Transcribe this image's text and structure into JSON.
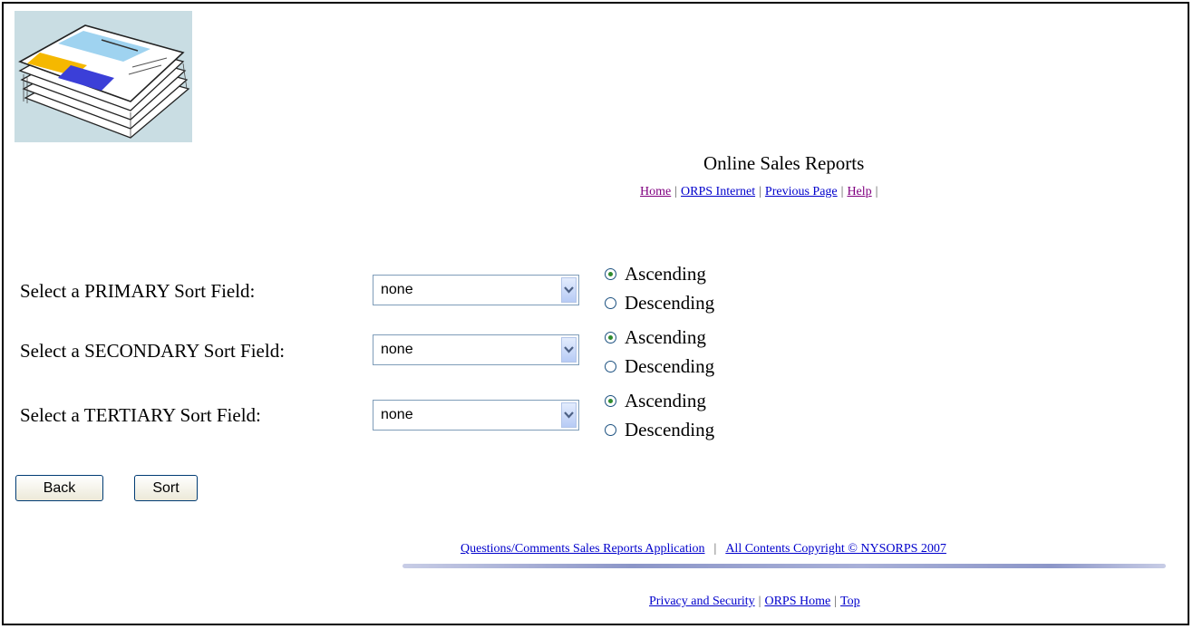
{
  "header": {
    "title": "Online Sales Reports",
    "nav": [
      {
        "label": "Home"
      },
      {
        "label": "ORPS Internet"
      },
      {
        "label": "Previous Page"
      },
      {
        "label": "Help"
      }
    ]
  },
  "sort_rows": [
    {
      "label": "Select a PRIMARY Sort Field:",
      "selected": "none",
      "order_options": [
        "Ascending",
        "Descending"
      ],
      "checked": "Ascending"
    },
    {
      "label": "Select a SECONDARY Sort Field:",
      "selected": "none",
      "order_options": [
        "Ascending",
        "Descending"
      ],
      "checked": "Ascending"
    },
    {
      "label": "Select a TERTIARY Sort Field:",
      "selected": "none",
      "order_options": [
        "Ascending",
        "Descending"
      ],
      "checked": "Ascending"
    }
  ],
  "buttons": {
    "back": "Back",
    "sort": "Sort"
  },
  "footer": {
    "questions_link": "Questions/Comments Sales Reports Application",
    "copyright_link": "All Contents Copyright © NYSORPS 2007",
    "links": [
      {
        "label": "Privacy and Security"
      },
      {
        "label": "ORPS Home"
      },
      {
        "label": "Top"
      }
    ]
  },
  "colors": {
    "link": "#0000cc",
    "visited_link": "#800080",
    "logo_background": "#c9dde3"
  },
  "icons": {
    "logo": "newspaper-stack-icon",
    "dropdown": "chevron-down-icon"
  }
}
